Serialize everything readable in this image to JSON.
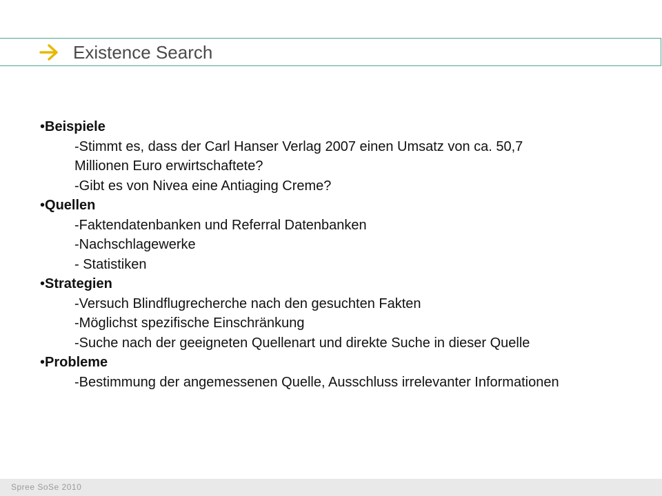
{
  "header": {
    "title": "Existence Search",
    "icon": "arrow-right-icon",
    "accent_color": "#4fa592",
    "icon_color": "#e8b800"
  },
  "sections": [
    {
      "heading": "Beispiele",
      "items": [
        "-Stimmt es, dass der Carl Hanser Verlag 2007 einen Umsatz von ca. 50,7 Millionen Euro erwirtschaftete?",
        "-Gibt es von Nivea eine Antiaging Creme?"
      ]
    },
    {
      "heading": "Quellen",
      "items": [
        "-Faktendatenbanken und Referral Datenbanken",
        "-Nachschlagewerke",
        "- Statistiken"
      ]
    },
    {
      "heading": "Strategien",
      "items": [
        "-Versuch Blindflugrecherche nach den gesuchten Fakten",
        "-Möglichst spezifische Einschränkung",
        "-Suche nach der geeigneten Quellenart und direkte Suche in dieser Quelle"
      ]
    },
    {
      "heading": "Probleme",
      "items": [
        "-Bestimmung der angemessenen Quelle, Ausschluss irrelevanter Informationen"
      ]
    }
  ],
  "footer": {
    "text": "Spree SoSe 2010"
  }
}
